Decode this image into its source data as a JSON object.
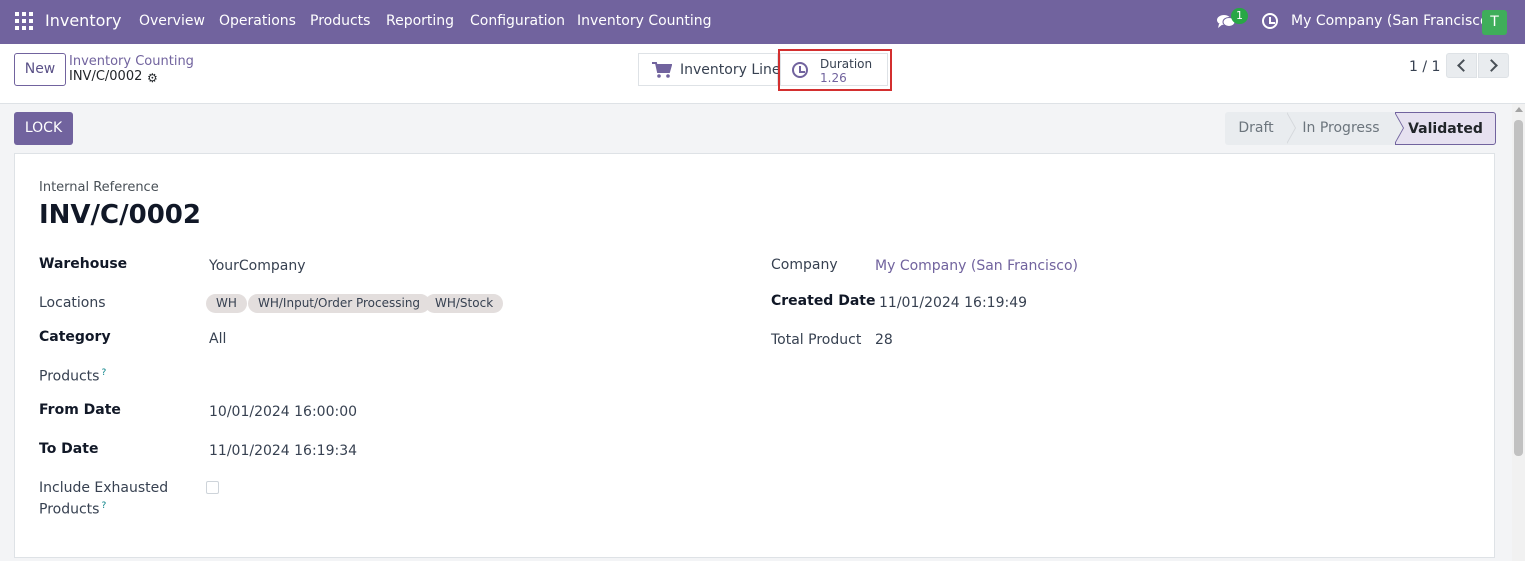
{
  "nav": {
    "app_name": "Inventory",
    "menu": [
      "Overview",
      "Operations",
      "Products",
      "Reporting",
      "Configuration",
      "Inventory Counting"
    ],
    "chat_badge": "1",
    "company": "My Company (San Francisco)",
    "avatar_initial": "T",
    "bg_color": "#71639e"
  },
  "control": {
    "new_label": "New",
    "breadcrumb_parent": "Inventory Counting",
    "breadcrumb_current": "INV/C/0002",
    "inventory_line_label": "Inventory Line",
    "duration_label": "Duration",
    "duration_value": "1.26",
    "pager": "1 / 1"
  },
  "actions": {
    "lock_label": "LOCK"
  },
  "stages": [
    "Draft",
    "In Progress",
    "Validated"
  ],
  "form": {
    "ref_label": "Internal Reference",
    "ref_value": "INV/C/0002",
    "warehouse_label": "Warehouse",
    "warehouse_value": "YourCompany",
    "locations_label": "Locations",
    "locations": [
      "WH",
      "WH/Input/Order Processing",
      "WH/Stock"
    ],
    "category_label": "Category",
    "category_value": "All",
    "products_label": "Products",
    "from_date_label": "From Date",
    "from_date_value": "10/01/2024 16:00:00",
    "to_date_label": "To Date",
    "to_date_value": "11/01/2024 16:19:34",
    "include_exhausted_label_1": "Include Exhausted",
    "include_exhausted_label_2": "Products",
    "include_exhausted_checked": false,
    "company_label": "Company",
    "company_value": "My Company (San Francisco)",
    "created_date_label": "Created Date",
    "created_date_value": "11/01/2024 16:19:49",
    "total_product_label": "Total Product",
    "total_product_value": "28",
    "help_mark": "?"
  }
}
